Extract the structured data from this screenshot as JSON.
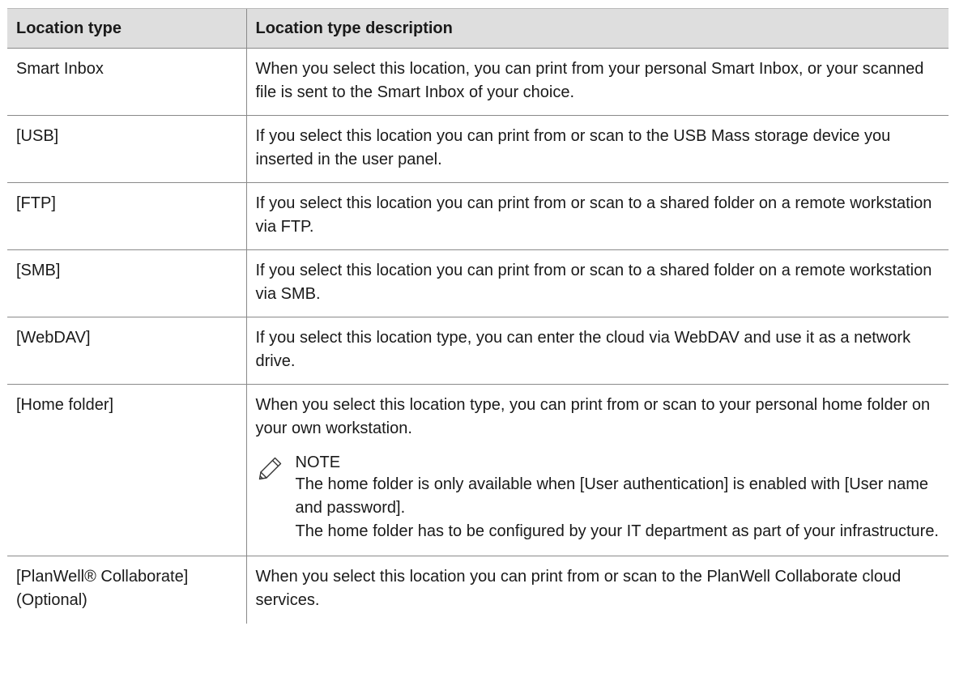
{
  "table": {
    "headers": [
      "Location type",
      "Location type description"
    ],
    "rows": [
      {
        "type": "Smart Inbox",
        "description": "When you select this location, you can print from your personal Smart Inbox, or your scanned file is sent to the Smart Inbox of your choice."
      },
      {
        "type": "[USB]",
        "description": "If you select this location you can print from or scan to the USB Mass storage device you inserted in the user panel."
      },
      {
        "type": "[FTP]",
        "description": "If you select this location you can print from or scan to a shared folder on a remote workstation via FTP."
      },
      {
        "type": "[SMB]",
        "description": "If you select this location you can print from or scan to a shared folder on a remote workstation via SMB."
      },
      {
        "type": "[WebDAV]",
        "description": "If you select this location type, you can enter the cloud via WebDAV and use it as a network drive."
      },
      {
        "type": "[Home folder]",
        "description": "When you select this location type, you can print from or scan to your personal home folder on your own workstation.",
        "note": {
          "icon": "pencil-icon",
          "title": "NOTE",
          "lines": [
            "The home folder is only available when [User authentication] is enabled with [User name and password].",
            "The home folder has to be configured by your IT department as part of your infrastructure."
          ]
        }
      },
      {
        "type": "[PlanWell® Collaborate] (Optional)",
        "description": "When you select this location you can print from or scan to the PlanWell Collaborate cloud services."
      }
    ]
  }
}
